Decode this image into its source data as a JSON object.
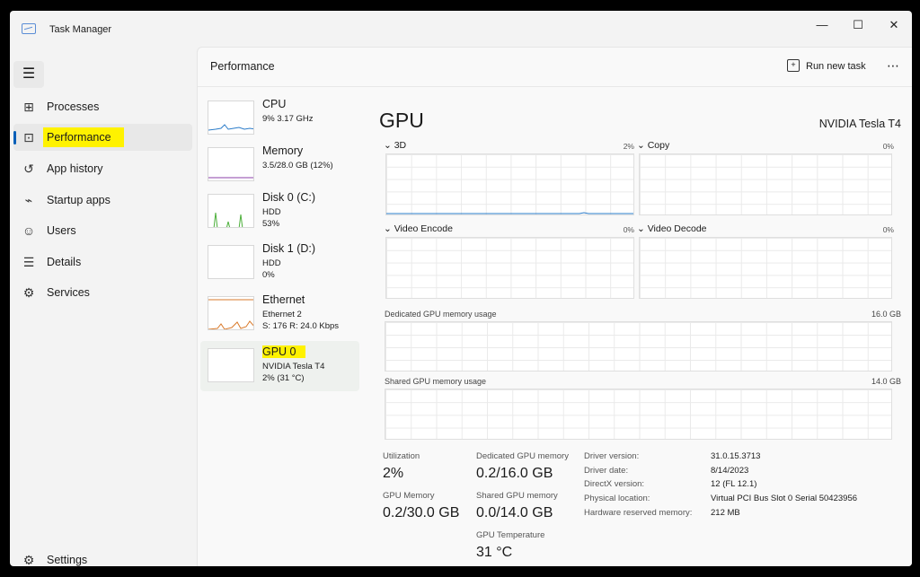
{
  "app": {
    "title": "Task Manager"
  },
  "window_controls": {
    "minimize": "—",
    "maximize": "☐",
    "close": "✕"
  },
  "sidebar": {
    "menu_icon": "hamburger-icon",
    "items": [
      {
        "label": "Processes",
        "icon": "processes-icon",
        "glyph": "⊞"
      },
      {
        "label": "Performance",
        "icon": "performance-icon",
        "glyph": "⊡"
      },
      {
        "label": "App history",
        "icon": "history-icon",
        "glyph": "↺"
      },
      {
        "label": "Startup apps",
        "icon": "startup-icon",
        "glyph": "⌁"
      },
      {
        "label": "Users",
        "icon": "users-icon",
        "glyph": "☺"
      },
      {
        "label": "Details",
        "icon": "details-icon",
        "glyph": "☰"
      },
      {
        "label": "Services",
        "icon": "services-icon",
        "glyph": "⚙"
      }
    ],
    "settings": {
      "label": "Settings",
      "icon": "settings-icon",
      "glyph": "⚙"
    }
  },
  "header": {
    "title": "Performance",
    "run_task": "Run new task",
    "more": "⋯"
  },
  "devices": [
    {
      "name": "CPU",
      "sub": [
        "9% 3.17 GHz"
      ]
    },
    {
      "name": "Memory",
      "sub": [
        "3.5/28.0 GB (12%)"
      ]
    },
    {
      "name": "Disk 0 (C:)",
      "sub": [
        "HDD",
        "53%"
      ]
    },
    {
      "name": "Disk 1 (D:)",
      "sub": [
        "HDD",
        "0%"
      ]
    },
    {
      "name": "Ethernet",
      "sub": [
        "Ethernet 2",
        "S: 176 R: 24.0 Kbps"
      ]
    },
    {
      "name": "GPU 0",
      "sub": [
        "NVIDIA Tesla T4",
        "2% (31 °C)"
      ]
    }
  ],
  "gpu": {
    "title": "GPU",
    "model": "NVIDIA Tesla T4",
    "engines": [
      {
        "label": "3D",
        "pct": "2%"
      },
      {
        "label": "Copy",
        "pct": "0%"
      },
      {
        "label": "Video Encode",
        "pct": "0%"
      },
      {
        "label": "Video Decode",
        "pct": "0%"
      }
    ],
    "dedicated_label": "Dedicated GPU memory usage",
    "dedicated_max": "16.0 GB",
    "shared_label": "Shared GPU memory usage",
    "shared_max": "14.0 GB",
    "stats": {
      "utilization_label": "Utilization",
      "utilization": "2%",
      "dedicated_label": "Dedicated GPU memory",
      "dedicated": "0.2/16.0 GB",
      "gpu_memory_label": "GPU Memory",
      "gpu_memory": "0.2/30.0 GB",
      "shared_label": "Shared GPU memory",
      "shared": "0.0/14.0 GB",
      "temp_label": "GPU Temperature",
      "temp": "31 °C"
    },
    "info": [
      {
        "k": "Driver version:",
        "v": "31.0.15.3713"
      },
      {
        "k": "Driver date:",
        "v": "8/14/2023"
      },
      {
        "k": "DirectX version:",
        "v": "12 (FL 12.1)"
      },
      {
        "k": "Physical location:",
        "v": "Virtual PCI Bus Slot 0 Serial 50423956"
      },
      {
        "k": "Hardware reserved memory:",
        "v": "212 MB"
      }
    ]
  }
}
